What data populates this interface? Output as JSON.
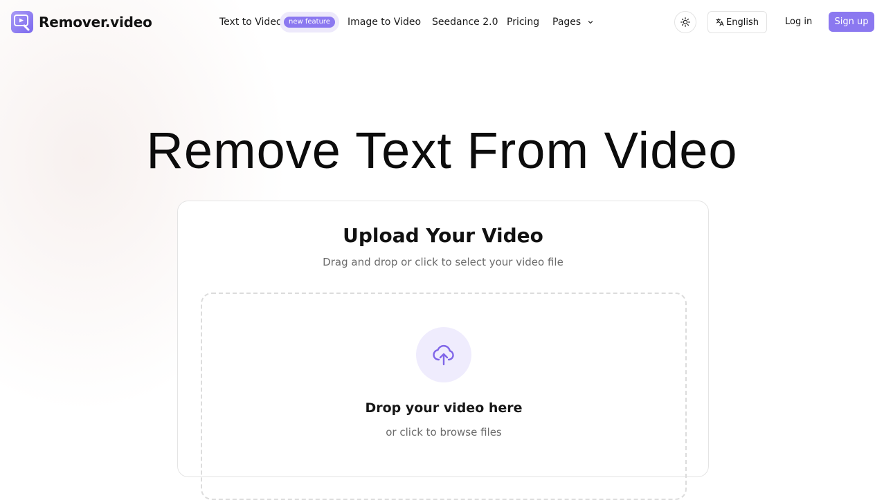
{
  "brand": {
    "name": "Remover.video",
    "logo_icon": "video-play-icon",
    "accent_color": "#8b78f0"
  },
  "nav": {
    "text_to_video": "Text to Video",
    "new_badge": "new feature",
    "image_to_video": "Image to Video",
    "seedance": "Seedance 2.0",
    "pricing": "Pricing",
    "pages": "Pages"
  },
  "header_actions": {
    "theme_icon": "sun-icon",
    "language": "English",
    "language_icon": "translate-icon",
    "login": "Log in",
    "signup": "Sign up"
  },
  "hero": {
    "title": "Remove Text From Video"
  },
  "upload": {
    "title": "Upload Your Video",
    "subtitle": "Drag and drop or click to select your video file",
    "icon": "cloud-upload-icon",
    "drop_title": "Drop your video here",
    "drop_subtitle": "or click to browse files"
  }
}
